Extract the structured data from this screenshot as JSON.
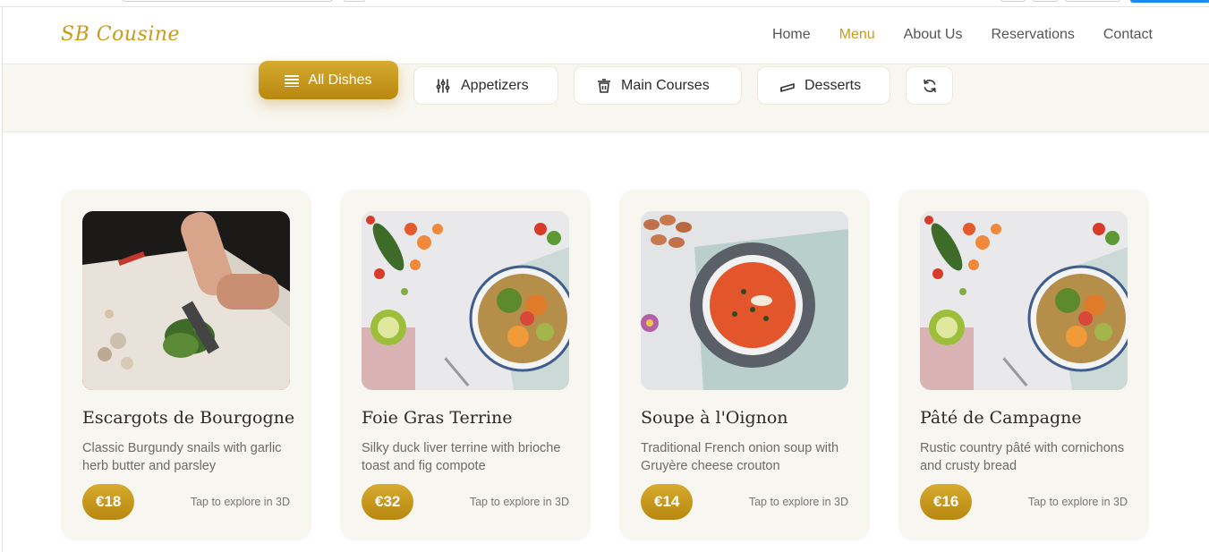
{
  "brand": {
    "logo": "SB Cousine",
    "accent": "#c99a1b"
  },
  "nav": {
    "items": [
      "Home",
      "Menu",
      "About Us",
      "Reservations",
      "Contact"
    ],
    "active": "Menu"
  },
  "filters": {
    "items": [
      {
        "label": "All Dishes",
        "icon": "list-icon",
        "active": true
      },
      {
        "label": "Appetizers",
        "icon": "utensils-icon",
        "active": false
      },
      {
        "label": "Main Courses",
        "icon": "pot-icon",
        "active": false
      },
      {
        "label": "Desserts",
        "icon": "cake-slice-icon",
        "active": false
      },
      {
        "label": "",
        "icon": "refresh-icon",
        "active": false
      }
    ]
  },
  "cards": [
    {
      "title": "Escargots de Bourgogne",
      "description": "Classic Burgundy snails with garlic herb butter and parsley",
      "price": "€18",
      "hint": "Tap to explore in 3D",
      "image": "chef-chopping-herbs"
    },
    {
      "title": "Foie Gras Terrine",
      "description": "Silky duck liver terrine with brioche toast and fig compote",
      "price": "€32",
      "hint": "Tap to explore in 3D",
      "image": "vegetable-bowl"
    },
    {
      "title": "Soupe à l'Oignon",
      "description": "Traditional French onion soup with Gruyère cheese crouton",
      "price": "€14",
      "hint": "Tap to explore in 3D",
      "image": "tomato-soup-bowl"
    },
    {
      "title": "Pâté de Campagne",
      "description": "Rustic country pâté with cornichons and crusty bread",
      "price": "€16",
      "hint": "Tap to explore in 3D",
      "image": "vegetable-bowl"
    }
  ]
}
